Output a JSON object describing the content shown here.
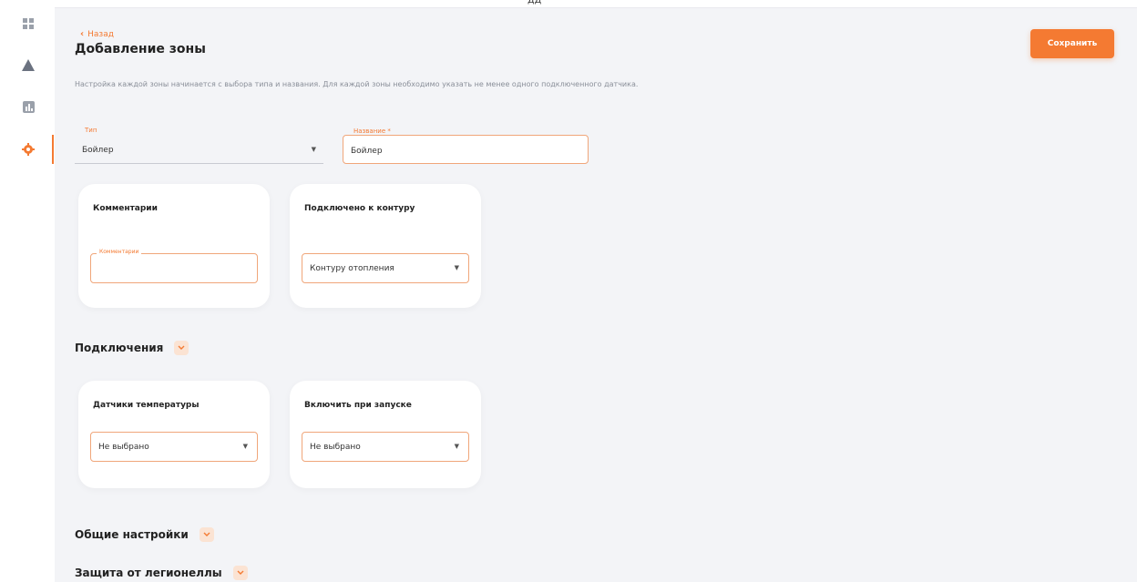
{
  "topbar": {
    "label": "дд"
  },
  "header": {
    "back_label": "Назад",
    "title": "Добавление зоны",
    "save_label": "Сохранить"
  },
  "description": "Настройка каждой зоны начинается с выбора типа и названия. Для каждой зоны необходимо указать не менее одного подключенного датчика.",
  "form": {
    "type": {
      "label": "Тип",
      "value": "Бойлер"
    },
    "name": {
      "label": "Название *",
      "value": "Бойлер"
    }
  },
  "cards": {
    "comment": {
      "title": "Комментарии",
      "input_label": "Комментарии",
      "input_value": ""
    },
    "circuit": {
      "title": "Подключено к контуру",
      "value": "Контуру отопления"
    },
    "temp_sensors": {
      "title": "Датчики температуры",
      "value": "Не выбрано"
    },
    "enable_on_start": {
      "title": "Включить при запуске",
      "value": "Не выбрано"
    }
  },
  "sections": {
    "connections": "Подключения",
    "general": "Общие настройки",
    "legionella": "Защита от легионеллы"
  },
  "colors": {
    "accent": "#f47a32",
    "background": "#f3f4f7"
  },
  "icons": {
    "sidebar": [
      "dashboard-icon",
      "warning-icon",
      "chart-icon",
      "settings-icon"
    ]
  }
}
